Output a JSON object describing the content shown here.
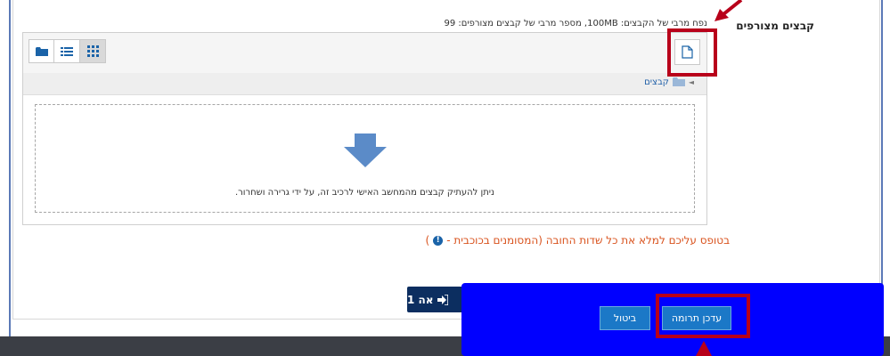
{
  "form": {
    "field_label": "קבצים מצורפים",
    "max_info": "נפח מרבי של הקבצים: 100MB, מספר מרבי של קבצים מצורפים: 99",
    "required_note": "בטופס עליכם למלא את כל שדות החובה (המסומנים בכוכבית -",
    "required_note_tail": ")",
    "required_icon": "!"
  },
  "filepicker": {
    "path_label": "קבצים",
    "drop_text": "ניתן להעתיק קבצים מהמחשב האישי לרכיב זה, על ידי גרירה ושחרור.",
    "view_icons": [
      "folder-icon",
      "list-icon",
      "grid-icon"
    ],
    "active_view": "grid-icon"
  },
  "buttons": {
    "next_label": "אה 1",
    "cancel_label": "ביטול",
    "save_label": "עדכן תרומה"
  },
  "colors": {
    "overlay": "#0000ff",
    "highlight": "#b8001a",
    "button": "#1b78c7",
    "next_button": "#0c2e60",
    "required_text": "#d9531e"
  }
}
